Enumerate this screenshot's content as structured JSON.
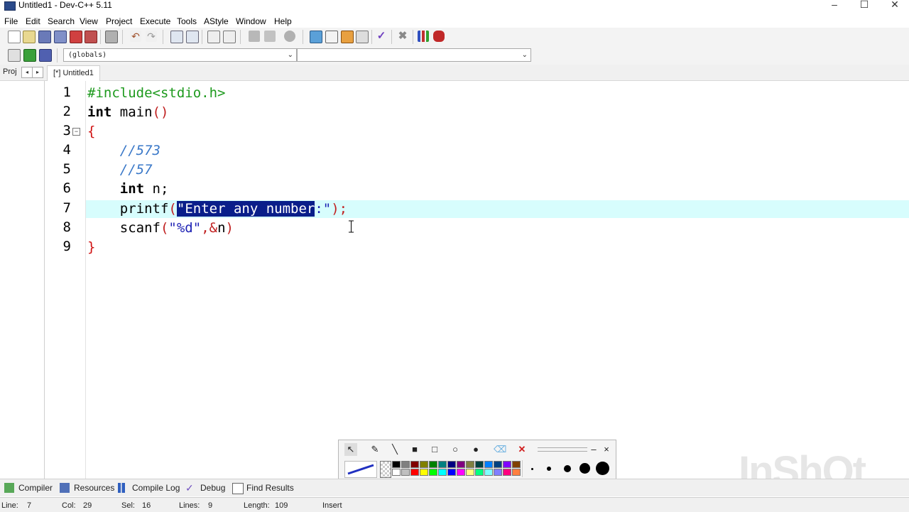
{
  "window": {
    "title": "Untitled1 - Dev-C++ 5.11",
    "minimize": "–",
    "maximize": "☐",
    "close": "✕"
  },
  "menu": [
    "File",
    "Edit",
    "Search",
    "View",
    "Project",
    "Execute",
    "Tools",
    "AStyle",
    "Window",
    "Help"
  ],
  "toolbar2": {
    "scope_combo": "(globals)",
    "func_combo": ""
  },
  "tabs": {
    "project_tab": "Proj",
    "nav_left": "◂",
    "nav_right": "▸",
    "file_tab": "[*] Untitled1"
  },
  "editor": {
    "line_numbers": [
      "1",
      "2",
      "3",
      "4",
      "5",
      "6",
      "7",
      "8",
      "9"
    ],
    "fold_marker": "−",
    "lines": {
      "l1": "#include<stdio.h>",
      "l2_kw": "int",
      "l2_rest": " main",
      "l2_paren": "()",
      "l3": "{",
      "l4": "//573",
      "l5": "//57",
      "l6_kw": "int",
      "l6_rest": " n;",
      "l7_fn": "printf",
      "l7_open": "(",
      "l7_q1": "\"",
      "l7_sel": "Enter any number",
      "l7_after": ":\"",
      "l7_close": ");",
      "l8_fn": "scanf",
      "l8_open": "(",
      "l8_fmt": "\"%d\"",
      "l8_comma": ",",
      "l8_amp": "&",
      "l8_var": "n",
      "l8_close": ")",
      "l9": "}"
    },
    "current_line": 7
  },
  "paint_toolbar": {
    "colors": [
      "#000000",
      "#808080",
      "#800000",
      "#808000",
      "#008000",
      "#008080",
      "#000080",
      "#800080",
      "#808040",
      "#004040",
      "#0080ff",
      "#004080",
      "#8000ff",
      "#804000",
      "#ffffff",
      "#c0c0c0",
      "#ff0000",
      "#ffff00",
      "#00ff00",
      "#00ffff",
      "#0000ff",
      "#ff00ff",
      "#ffff80",
      "#00ff80",
      "#80ffff",
      "#8080ff",
      "#ff0080",
      "#ff8040"
    ],
    "min": "–",
    "close": "×"
  },
  "bottom_tabs": [
    "Compiler",
    "Resources",
    "Compile Log",
    "Debug",
    "Find Results"
  ],
  "status": {
    "line_label": "Line:",
    "line_value": "7",
    "col_label": "Col:",
    "col_value": "29",
    "sel_label": "Sel:",
    "sel_value": "16",
    "lines_label": "Lines:",
    "lines_value": "9",
    "length_label": "Length:",
    "length_value": "109",
    "mode": "Insert"
  },
  "watermark": "InShOt"
}
